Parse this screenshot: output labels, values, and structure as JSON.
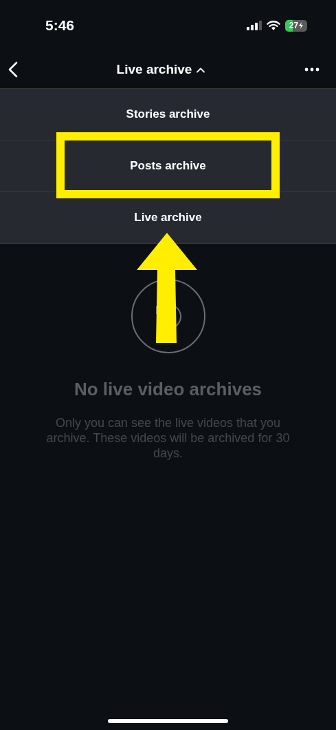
{
  "status_bar": {
    "time": "5:46",
    "battery": "27"
  },
  "nav": {
    "title": "Live archive",
    "expanded": true
  },
  "menu": [
    {
      "label": "Stories archive",
      "highlighted": false
    },
    {
      "label": "Posts archive",
      "highlighted": true
    },
    {
      "label": "Live archive",
      "highlighted": false
    }
  ],
  "empty_state": {
    "title": "No live video archives",
    "description": "Only you can see the live videos that you archive. These videos will be archived for 30 days."
  }
}
